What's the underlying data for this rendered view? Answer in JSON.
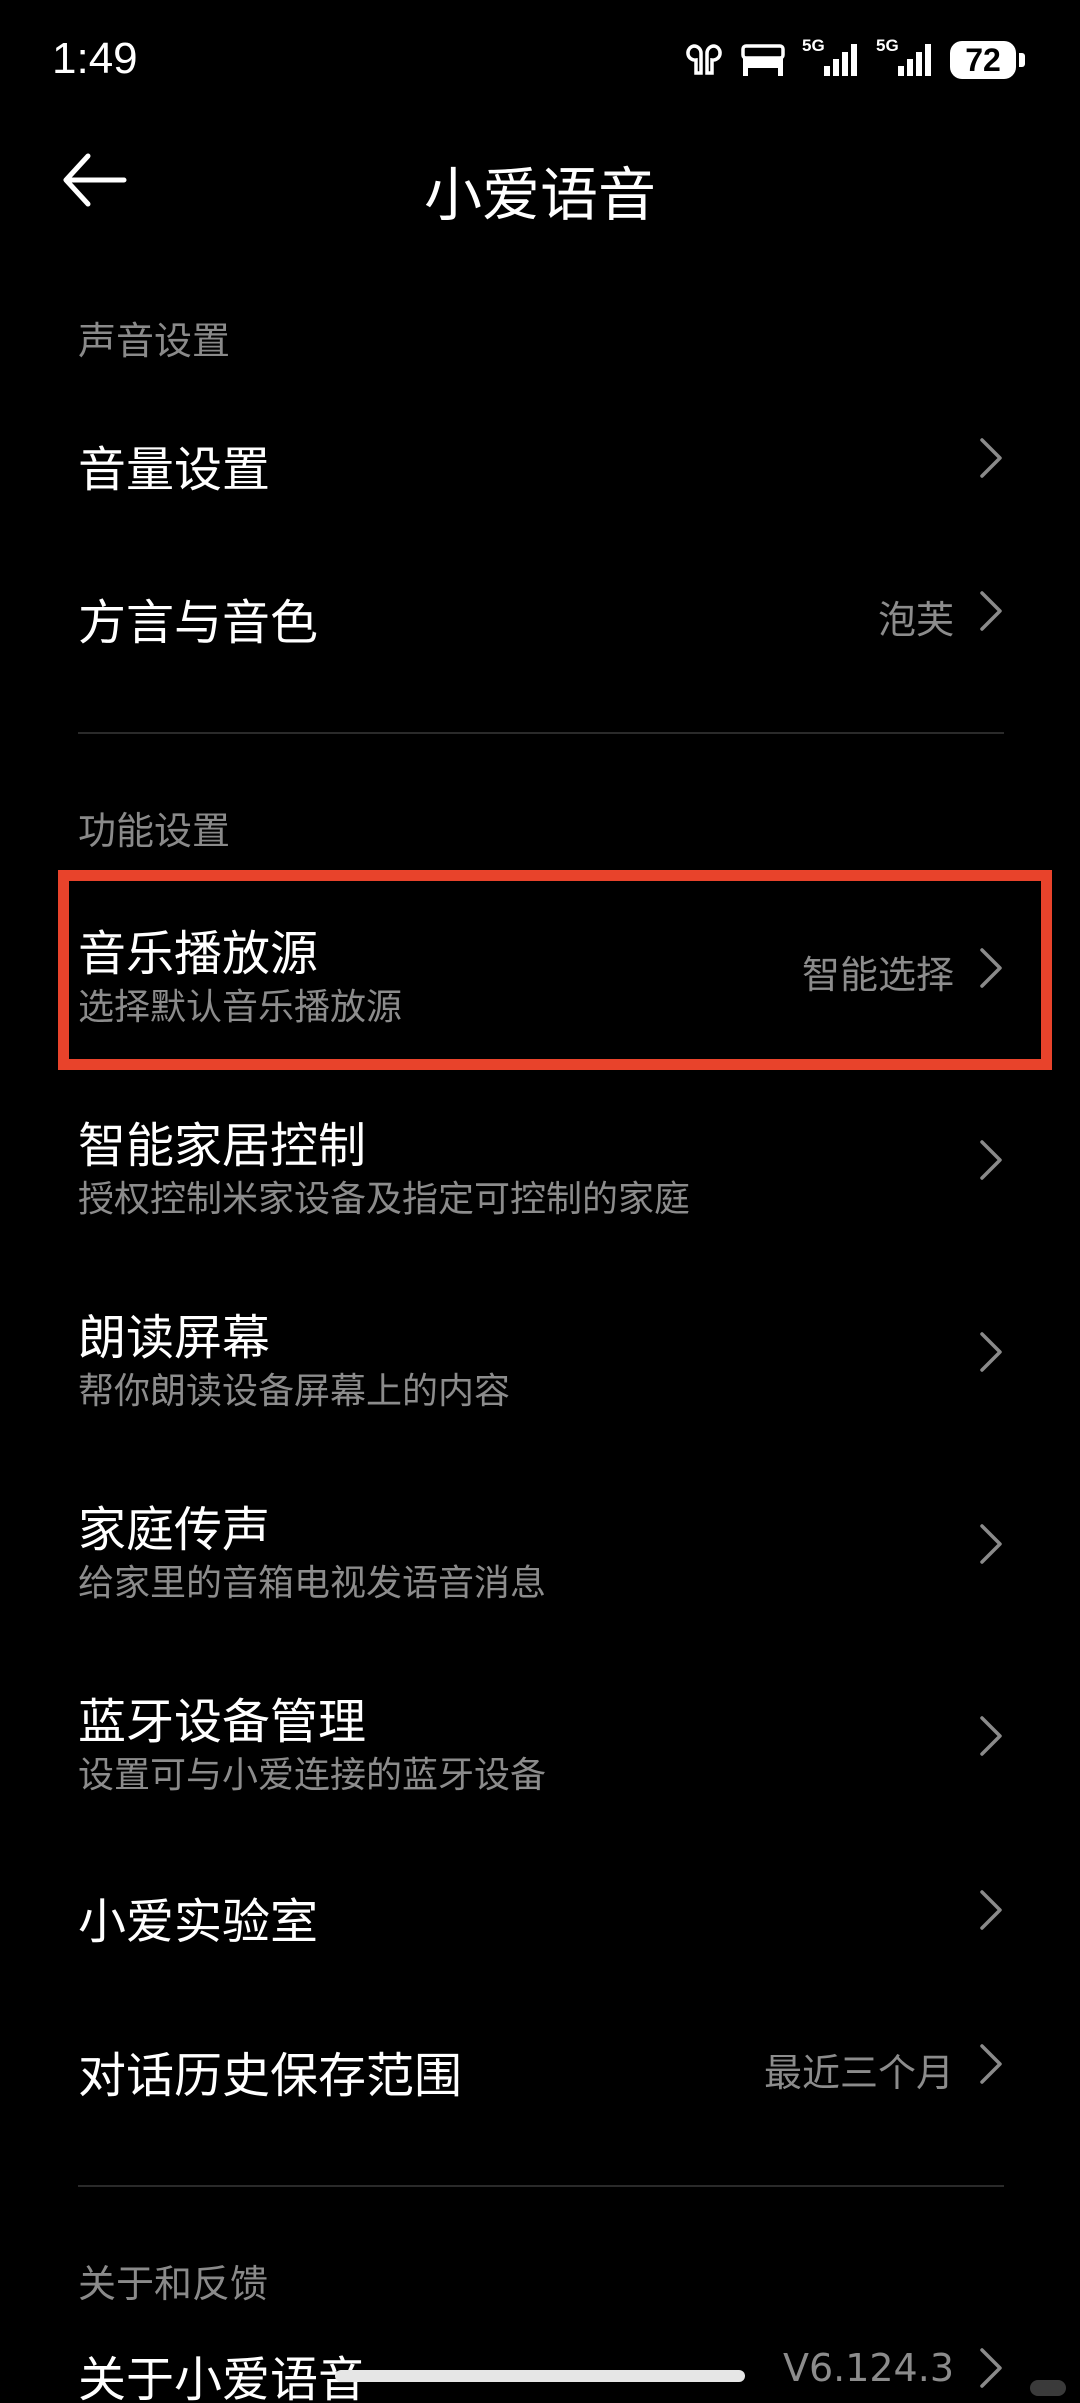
{
  "status_bar": {
    "time": "1:49",
    "network1": "5G",
    "network2": "5G",
    "battery": "72"
  },
  "header": {
    "title": "小爱语音"
  },
  "sections": {
    "sound": {
      "header": "声音设置",
      "items": [
        {
          "title": "音量设置",
          "value": ""
        },
        {
          "title": "方言与音色",
          "value": "泡芙"
        }
      ]
    },
    "function": {
      "header": "功能设置",
      "items": [
        {
          "title": "音乐播放源",
          "subtitle": "选择默认音乐播放源",
          "value": "智能选择"
        },
        {
          "title": "智能家居控制",
          "subtitle": "授权控制米家设备及指定可控制的家庭",
          "value": ""
        },
        {
          "title": "朗读屏幕",
          "subtitle": "帮你朗读设备屏幕上的内容",
          "value": ""
        },
        {
          "title": "家庭传声",
          "subtitle": "给家里的音箱电视发语音消息",
          "value": ""
        },
        {
          "title": "蓝牙设备管理",
          "subtitle": "设置可与小爱连接的蓝牙设备",
          "value": ""
        },
        {
          "title": "小爱实验室",
          "value": ""
        },
        {
          "title": "对话历史保存范围",
          "value": "最近三个月"
        }
      ]
    },
    "about": {
      "header": "关于和反馈",
      "items": [
        {
          "title": "关于小爱语音",
          "value": "V6.124.3"
        }
      ]
    }
  },
  "colors": {
    "background": "#000000",
    "highlight": "#e8432b",
    "secondary_text": "#8c8c8c"
  }
}
